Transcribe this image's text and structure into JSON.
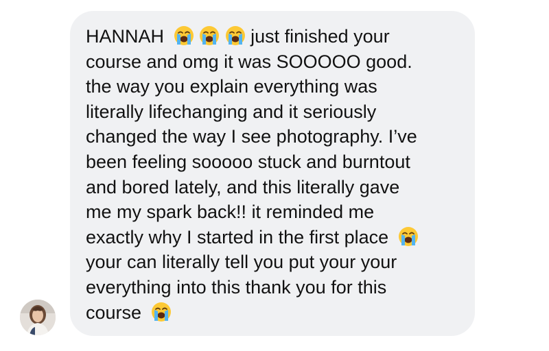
{
  "conversation": {
    "sender_avatar_icon": "user-avatar-photo",
    "message": {
      "emoji_icon": "loudly-crying-face-emoji",
      "lines": [
        [
          "HANNAH",
          "🐭",
          "🐭",
          "🐭",
          "just finished your"
        ],
        [
          "course and omg it was SOOOOO good."
        ],
        [
          "the way you explain everything was"
        ],
        [
          "literally lifechanging and it seriously"
        ],
        [
          "changed the way I see photography. I’ve"
        ],
        [
          "been feeling sooooo stuck and burntout"
        ],
        [
          "and bored lately, and this literally gave"
        ],
        [
          "me my spark back!! it reminded me"
        ],
        [
          "exactly why I started in the first place",
          "🐭"
        ],
        [
          "your can literally tell you put your your"
        ],
        [
          "everything into this thank you for this"
        ],
        [
          "course",
          "🐭"
        ]
      ]
    }
  }
}
